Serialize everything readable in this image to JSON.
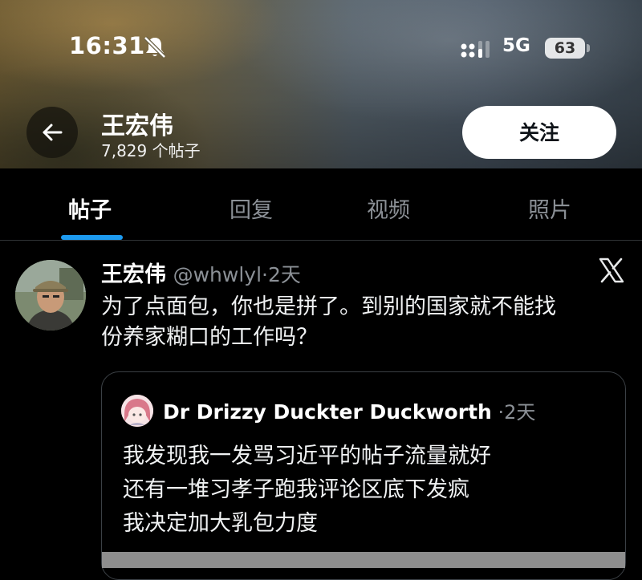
{
  "status_bar": {
    "time": "16:31",
    "network": "5G",
    "battery": "63",
    "icons": [
      "bell-muted-icon",
      "signal-icon",
      "battery-icon"
    ]
  },
  "header": {
    "name": "王宏伟",
    "post_count": "7,829 个帖子",
    "follow_label": "关注",
    "back_icon": "arrow-left-icon"
  },
  "tabs": [
    {
      "label": "帖子",
      "active": true
    },
    {
      "label": "回复",
      "active": false
    },
    {
      "label": "视频",
      "active": false
    },
    {
      "label": "照片",
      "active": false
    }
  ],
  "accent_color": "#1d9bf0",
  "tweet": {
    "name": "王宏伟",
    "handle": "@whwlyl",
    "separator": "·",
    "time": "2天",
    "text_lines": [
      "为了点面包，你也是拼了。到别的国家就不能找",
      "份养家糊口的工作吗？"
    ],
    "source_icon": "x-logo-icon",
    "quote": {
      "name": "Dr Drizzy Duckter Duckworth",
      "separator": "·",
      "time": "2天",
      "text_lines": [
        "我发现我一发骂习近平的帖子流量就好",
        "还有一堆习孝子跑我评论区底下发疯",
        "我决定加大乳包力度"
      ]
    }
  }
}
